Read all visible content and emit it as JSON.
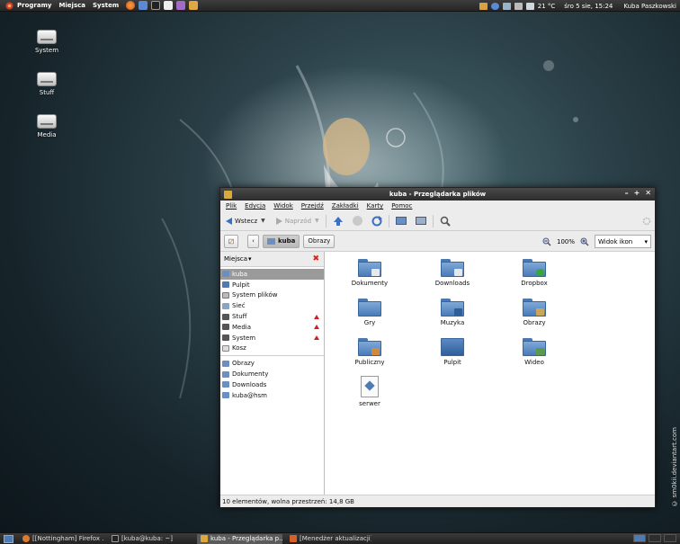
{
  "top_panel": {
    "menus": [
      "Programy",
      "Miejsca",
      "System"
    ],
    "temperature": "21 °C",
    "datetime": "śro  5 sie, 15:24",
    "user": "Kuba Paszkowski"
  },
  "desktop_icons": [
    "System",
    "Stuff",
    "Media"
  ],
  "window": {
    "title": "kuba - Przeglądarka plików",
    "menu": [
      "Plik",
      "Edycja",
      "Widok",
      "Przejdź",
      "Zakładki",
      "Karty",
      "Pomoc"
    ],
    "toolbar": {
      "back": "Wstecz",
      "forward": "Naprzód"
    },
    "location": {
      "current": "kuba",
      "next": "Obrazy"
    },
    "zoom": "100%",
    "view_mode": "Widok ikon",
    "sidebar": {
      "header": "Miejsca",
      "places": [
        "kuba",
        "Pulpit",
        "System plików",
        "Sieć",
        "Stuff",
        "Media",
        "System",
        "Kosz"
      ],
      "bookmarks": [
        "Obrazy",
        "Dokumenty",
        "Downloads",
        "kuba@hsm"
      ]
    },
    "files": [
      "Dokumenty",
      "Downloads",
      "Dropbox",
      "Gry",
      "Muzyka",
      "Obrazy",
      "Publiczny",
      "Pulpit",
      "Wideo",
      "serwer"
    ],
    "status": "10 elementów, wolna przestrzeń: 14,8 GB"
  },
  "taskbar": {
    "tasks": [
      "[[Nottingham] Firefox ...",
      "[kuba@kuba: ~]",
      "kuba - Przeglądarka p...",
      "[Menedżer aktualizacji]"
    ]
  },
  "credit": "© sm0kii.deviantart.com",
  "colors": {
    "accent": "#4a7bb8",
    "panel": "#2c2c2c",
    "eject": "#cc2222"
  }
}
